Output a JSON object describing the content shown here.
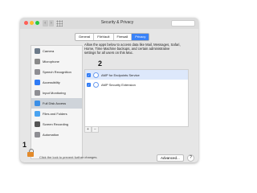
{
  "window": {
    "title": "Security & Privacy",
    "nav_back": "‹",
    "nav_forward": "›"
  },
  "tabs": [
    {
      "label": "General"
    },
    {
      "label": "FileVault"
    },
    {
      "label": "Firewall"
    },
    {
      "label": "Privacy",
      "active": true
    }
  ],
  "sidebar": {
    "items": [
      {
        "label": "Camera",
        "icon": "camera-icon",
        "color": "#6c7a89"
      },
      {
        "label": "Microphone",
        "icon": "microphone-icon",
        "color": "#8a8a8a"
      },
      {
        "label": "Speech Recognition",
        "icon": "speech-icon",
        "color": "#8e8e93"
      },
      {
        "label": "Accessibility",
        "icon": "accessibility-icon",
        "color": "#2f7bf5"
      },
      {
        "label": "Input Monitoring",
        "icon": "keyboard-icon",
        "color": "#8e8e93"
      },
      {
        "label": "Full Disk Access",
        "icon": "folder-icon",
        "color": "#3a8ee6",
        "selected": true
      },
      {
        "label": "Files and Folders",
        "icon": "folder-icon",
        "color": "#4aa3f0"
      },
      {
        "label": "Screen Recording",
        "icon": "screen-icon",
        "color": "#555555"
      },
      {
        "label": "Automation",
        "icon": "gear-icon",
        "color": "#8e8e93"
      }
    ]
  },
  "content": {
    "description": "Allow the apps below to access data like Mail, Messages, Safari, Home, Time Machine backups, and certain administrative settings for all users on this Mac.",
    "apps": [
      {
        "label": "AMP for Endpoints Service",
        "checked": true,
        "selected": true
      },
      {
        "label": "AMP Security Extension",
        "checked": true,
        "selected": false
      }
    ],
    "plus": "+",
    "minus": "−"
  },
  "footer": {
    "lock_text": "Click the lock to prevent further changes.",
    "advanced_label": "Advanced...",
    "help_label": "?"
  },
  "annotations": {
    "badge_1": "1",
    "badge_2": "2"
  }
}
